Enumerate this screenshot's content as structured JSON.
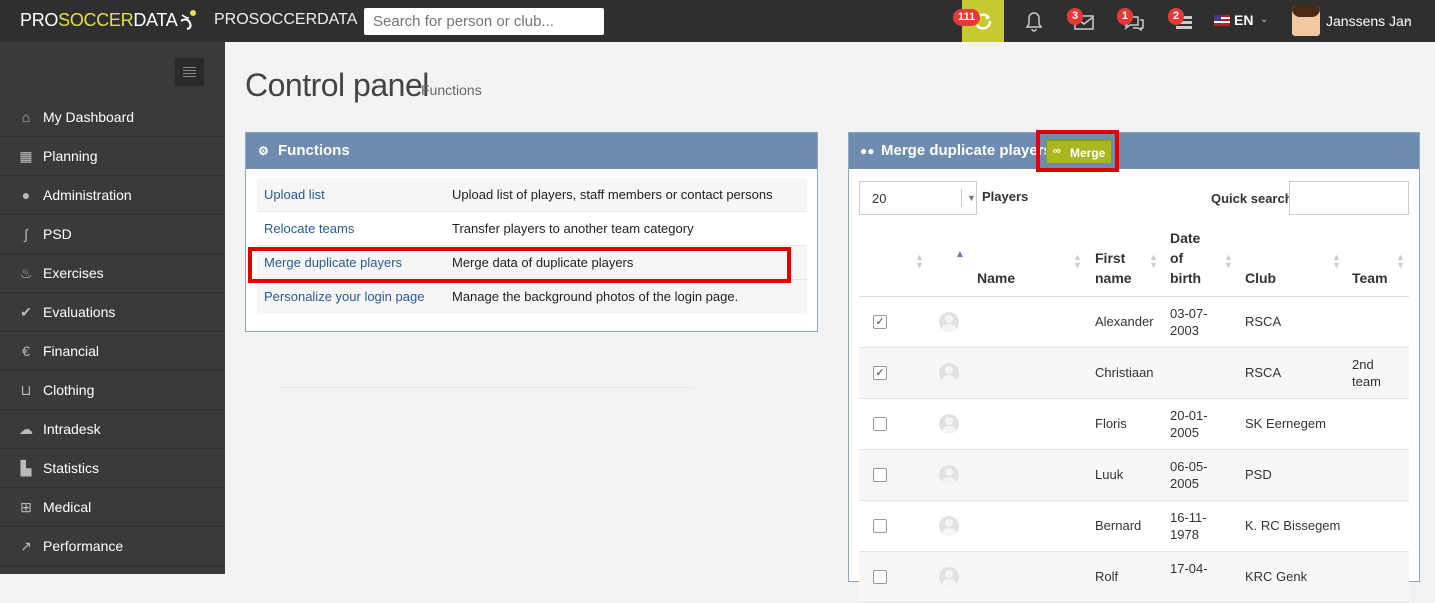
{
  "topbar": {
    "brand_a": "PRO",
    "brand_b": "SOCCER",
    "brand_c": "DATA",
    "brand2": "PROSOCCERDATA",
    "search_placeholder": "Search for person or club...",
    "badges": {
      "sync": "111",
      "messages": "3",
      "chat": "1",
      "list": "2"
    },
    "language": "EN",
    "user_name": "Janssens Jan",
    "colors": {
      "bar": "#2f2f2f",
      "sync_bg": "#c7ca2f",
      "badge": "#e53935"
    }
  },
  "sidebar": {
    "items": [
      {
        "label": "My Dashboard",
        "icon": "home-icon"
      },
      {
        "label": "Planning",
        "icon": "calendar-icon"
      },
      {
        "label": "Administration",
        "icon": "user-icon"
      },
      {
        "label": "PSD",
        "icon": "psd-icon"
      },
      {
        "label": "Exercises",
        "icon": "exercise-icon"
      },
      {
        "label": "Evaluations",
        "icon": "check-icon"
      },
      {
        "label": "Financial",
        "icon": "euro-icon"
      },
      {
        "label": "Clothing",
        "icon": "cart-icon"
      },
      {
        "label": "Intradesk",
        "icon": "cloud-icon"
      },
      {
        "label": "Statistics",
        "icon": "bar-chart-icon"
      },
      {
        "label": "Medical",
        "icon": "medkit-icon"
      },
      {
        "label": "Performance",
        "icon": "line-chart-icon"
      }
    ]
  },
  "page": {
    "title": "Control panel",
    "subtitle": "Functions"
  },
  "functions_panel": {
    "title": "Functions",
    "rows": [
      {
        "link": "Upload list",
        "desc": "Upload list of players, staff members or contact persons"
      },
      {
        "link": "Relocate teams",
        "desc": "Transfer players to another team category"
      },
      {
        "link": "Merge duplicate players",
        "desc": "Merge data of duplicate players"
      },
      {
        "link": "Personalize your login page",
        "desc": "Manage the background photos of the login page."
      }
    ]
  },
  "merge_panel": {
    "title": "Merge duplicate players",
    "merge_button": "Merge",
    "page_size": "20",
    "page_size_label": "Players",
    "quick_search_label": "Quick search:",
    "columns": {
      "name": "Name",
      "first_a": "First",
      "first_b": "name",
      "dob_a": "Date",
      "dob_b": "of",
      "dob_c": "birth",
      "club": "Club",
      "team": "Team"
    },
    "rows": [
      {
        "checked": "✓",
        "first": "Alexander",
        "dob_a": "03-07-",
        "dob_b": "2003",
        "club": "RSCA",
        "team_a": "",
        "team_b": ""
      },
      {
        "checked": "✓",
        "first": "Christiaan",
        "dob_a": "",
        "dob_b": "",
        "club": "RSCA",
        "team_a": "2nd",
        "team_b": "team"
      },
      {
        "checked": "",
        "first": "Floris",
        "dob_a": "20-01-",
        "dob_b": "2005",
        "club": "SK Eernegem",
        "team_a": "",
        "team_b": ""
      },
      {
        "checked": "",
        "first": "Luuk",
        "dob_a": "06-05-",
        "dob_b": "2005",
        "club": "PSD",
        "team_a": "",
        "team_b": ""
      },
      {
        "checked": "",
        "first": "Bernard",
        "dob_a": "16-11-",
        "dob_b": "1978",
        "club": "K. RC Bissegem",
        "team_a": "",
        "team_b": ""
      },
      {
        "checked": "",
        "first": "Rolf",
        "dob_a": "17-04-",
        "dob_b": "",
        "club": "KRC Genk",
        "team_a": "",
        "team_b": ""
      }
    ]
  }
}
